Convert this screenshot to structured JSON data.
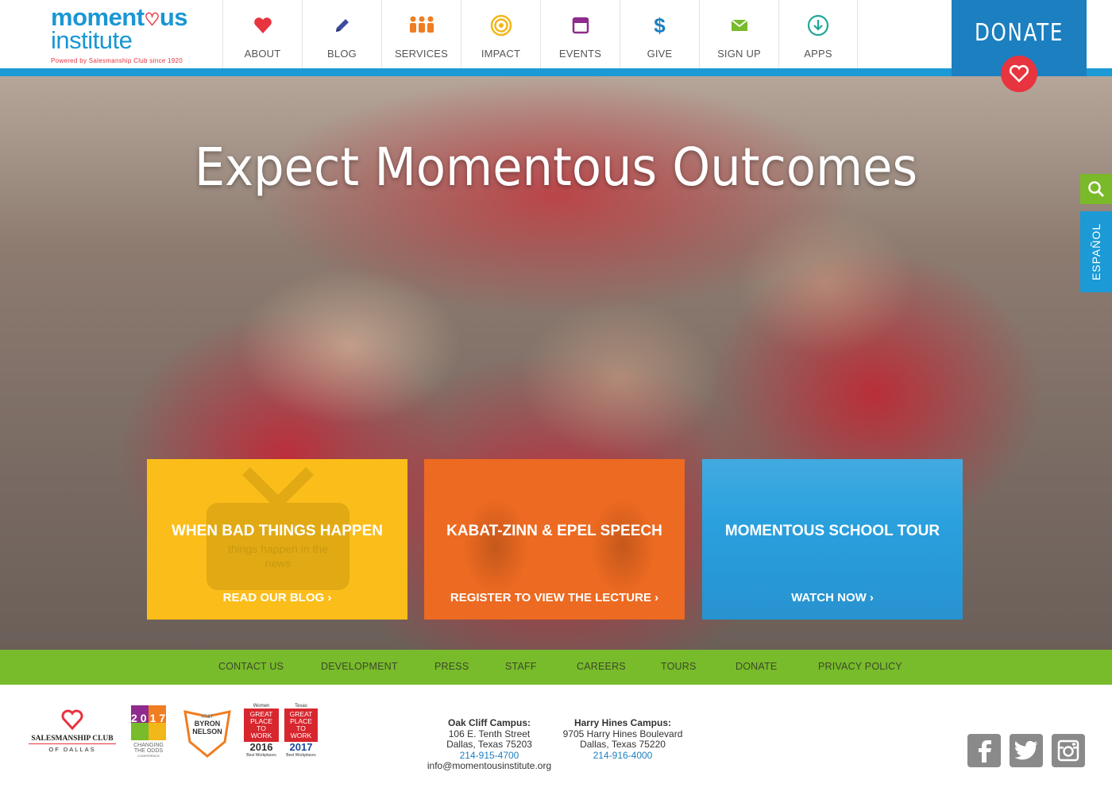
{
  "logo": {
    "line1a": "moment",
    "line1b": "us",
    "line2": "institute",
    "tagline": "Powered by Salesmanship Club since 1920"
  },
  "nav": [
    {
      "label": "ABOUT",
      "icon": "heart-icon",
      "color": "#e8343f"
    },
    {
      "label": "BLOG",
      "icon": "pencil-icon",
      "color": "#3d4a9e"
    },
    {
      "label": "SERVICES",
      "icon": "people-icon",
      "color": "#ef7d22"
    },
    {
      "label": "IMPACT",
      "icon": "target-icon",
      "color": "#f2b718"
    },
    {
      "label": "EVENTS",
      "icon": "calendar-icon",
      "color": "#8e2b8c"
    },
    {
      "label": "GIVE",
      "icon": "dollar-icon",
      "color": "#1b7fc0"
    },
    {
      "label": "SIGN UP",
      "icon": "envelope-icon",
      "color": "#78bb2b"
    },
    {
      "label": "APPS",
      "icon": "download-icon",
      "color": "#1fa79b"
    }
  ],
  "donate": {
    "label": "DONATE"
  },
  "hero": {
    "title": "Expect Momentous Outcomes"
  },
  "side": {
    "espanol": "ESPAÑOL"
  },
  "cards": [
    {
      "title": "WHEN BAD THINGS HAPPEN",
      "link": "READ OUR BLOG ›",
      "overlay_text": "things happen in the news"
    },
    {
      "title": "KABAT-ZINN & EPEL SPEECH",
      "link": "REGISTER TO VIEW THE LECTURE ›"
    },
    {
      "title": "MOMENTOUS SCHOOL TOUR",
      "link": "WATCH NOW ›"
    }
  ],
  "footer_nav": [
    "CONTACT US",
    "DEVELOPMENT",
    "PRESS",
    "STAFF",
    "CAREERS",
    "TOURS",
    "DONATE",
    "PRIVACY POLICY"
  ],
  "partners": {
    "salesmanship": {
      "line1": "SALESMANSHIP CLUB",
      "line2": "OF DALLAS"
    },
    "changing": {
      "year": "2017",
      "line1": "CHANGING",
      "line2": "THE ODDS",
      "line3": "CONFERENCE"
    },
    "byron": {
      "line1": "AT&T",
      "line2": "BYRON",
      "line3": "NELSON"
    },
    "gptw_women": {
      "top": "Women",
      "text": "GREAT PLACE TO WORK",
      "year": "2016",
      "sub": "Best Workplaces"
    },
    "gptw_texas": {
      "top": "Texas",
      "text": "GREAT PLACE TO WORK",
      "year": "2017",
      "sub": "Best Workplaces"
    }
  },
  "campuses": [
    {
      "name": "Oak Cliff Campus:",
      "street": "106 E. Tenth Street",
      "city": "Dallas, Texas 75203",
      "phone": "214-915-4700",
      "email": "info@momentousinstitute.org"
    },
    {
      "name": "Harry Hines Campus:",
      "street": "9705 Harry Hines Boulevard",
      "city": "Dallas, Texas 75220",
      "phone": "214-916-4000"
    }
  ],
  "social": [
    "facebook-icon",
    "twitter-icon",
    "instagram-icon"
  ]
}
